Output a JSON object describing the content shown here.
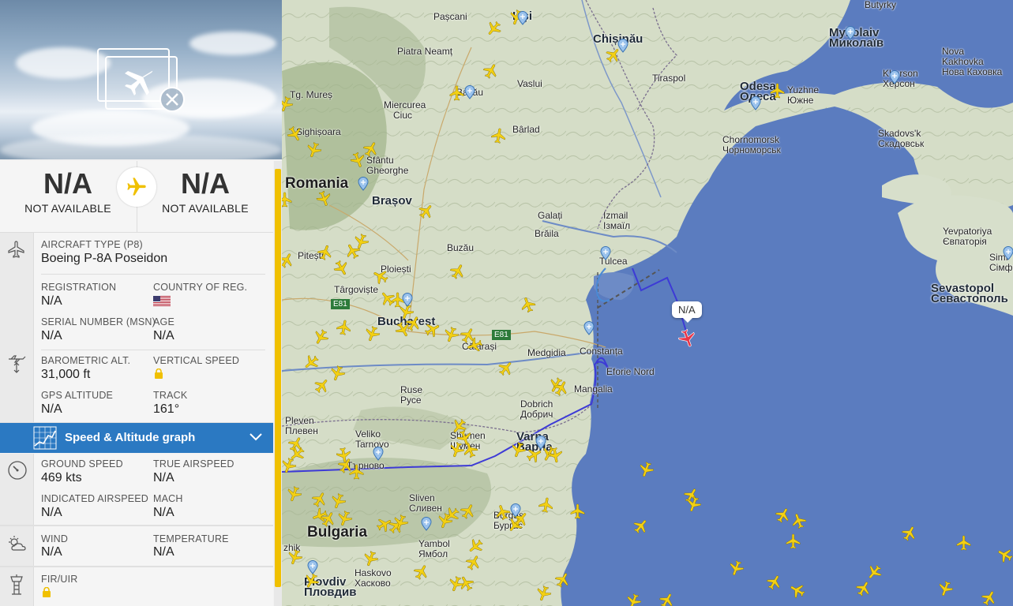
{
  "flight": {
    "origin_code": "N/A",
    "origin_name": "NOT AVAILABLE",
    "destination_code": "N/A",
    "destination_name": "NOT AVAILABLE"
  },
  "aircraft": {
    "type_label": "AIRCRAFT TYPE",
    "type_code": "(P8)",
    "type_value": "Boeing P-8A Poseidon",
    "registration_label": "REGISTRATION",
    "registration_value": "N/A",
    "country_label": "COUNTRY OF REG.",
    "country_flag": "us-flag",
    "serial_label": "SERIAL NUMBER (MSN)",
    "serial_value": "N/A",
    "age_label": "AGE",
    "age_value": "N/A"
  },
  "altitude": {
    "baro_label": "BAROMETRIC ALT.",
    "baro_value": "31,000 ft",
    "vspeed_label": "VERTICAL SPEED",
    "gps_label": "GPS ALTITUDE",
    "gps_value": "N/A",
    "track_label": "TRACK",
    "track_value": "161°"
  },
  "graph_bar": {
    "title": "Speed & Altitude graph"
  },
  "speed": {
    "ground_label": "GROUND SPEED",
    "ground_value": "469 kts",
    "tas_label": "TRUE AIRSPEED",
    "tas_value": "N/A",
    "ias_label": "INDICATED AIRSPEED",
    "ias_value": "N/A",
    "mach_label": "MACH",
    "mach_value": "N/A"
  },
  "weather": {
    "wind_label": "WIND",
    "wind_value": "N/A",
    "temp_label": "TEMPERATURE",
    "temp_value": "N/A"
  },
  "fir": {
    "label": "FIR/UIR"
  },
  "map": {
    "selected_tag": "N/A",
    "places": {
      "pascani": "Pașcani",
      "iasi": "Iași",
      "chisinau": "Chișinău",
      "mykolaiv": "Mykolaiv",
      "mykolaiv_alt": "Миколаїв",
      "piatra": "Piatra Neamț",
      "vaslui": "Vaslui",
      "nova_kakhovka": "Nova",
      "nova_kakhovka_2": "Kakhovka",
      "nova_kakhovka_alt": "Нова Каховка",
      "tiraspol": "Tiraspol",
      "bacau": "Bacău",
      "odesa": "Odesa",
      "odesa_alt": "Одеса",
      "yuzhne": "Yuzhne",
      "yuzhne_alt": "Южне",
      "kherson": "Kherson",
      "kherson_alt": "Херсон",
      "tg_mures": "Tg. Mureș",
      "miercurea": "Miercurea",
      "miercurea_2": "Ciuc",
      "barlad": "Bârlad",
      "sighisoara": "Sighișoara",
      "chornomorsk": "Chornomorsk",
      "chornomorsk_alt": "Чорноморськ",
      "skadovsk": "Skadovs'k",
      "skadovsk_alt": "Скадовськ",
      "sfantu": "Sfântu",
      "sfantu_2": "Gheorghe",
      "romania": "Romania",
      "brasov": "Brașov",
      "galati": "Galați",
      "izmail": "Izmail",
      "izmail_alt": "Ізмаїл",
      "braila": "Brăila",
      "yevpatoriya": "Yevpatoriya",
      "yevpatoriya_alt": "Євпаторія",
      "buzau": "Buzău",
      "tulcea": "Tulcea",
      "simf": "Simf",
      "simf_alt": "Сімфе",
      "pitesti": "Pitești",
      "ploiesti": "Ploiești",
      "targoviste": "Târgoviște",
      "sevastopol": "Sevastopol",
      "sevastopol_alt": "Севастополь",
      "e81": "E81",
      "bucharest": "Bucharest",
      "calarasi": "Călărași",
      "medgidia": "Medgidia",
      "constanta": "Constanța",
      "e81b": "E81",
      "eforie": "Eforie Nord",
      "ruse": "Ruse",
      "ruse_alt": "Русе",
      "mangalia": "Mangalia",
      "dobrich": "Dobrich",
      "dobrich_alt": "Добрич",
      "pleven": "Pleven",
      "pleven_alt": "Плевен",
      "veliko": "Veliko",
      "veliko_2": "Tarnovo",
      "shumen": "Shumen",
      "shumen_alt": "Шумен",
      "varna": "Varna",
      "varna_alt": "Варна",
      "tarnovo_alt": "Търново",
      "sliven": "Sliven",
      "sliven_alt": "Сливен",
      "burgas": "Burgas",
      "burgas_alt": "Бургас",
      "bulgaria": "Bulgaria",
      "yambol": "Yambol",
      "yambol_alt": "Ямбол",
      "khaskovo": "Haskovo",
      "khaskovo_alt": "Хасково",
      "plovdiv": "Plovdiv",
      "plovdiv_alt": "Пловдив",
      "zhik": "zhik",
      "butyrky": "Butyrky"
    }
  },
  "colors": {
    "sea": "#5b7cbf",
    "land": "#d7dfcb",
    "route": "#3d3ad6",
    "plane": "#f3d013",
    "selected_plane": "#e8364a",
    "panel_blue": "#2b79c2",
    "accent_yellow": "#f0c000"
  }
}
